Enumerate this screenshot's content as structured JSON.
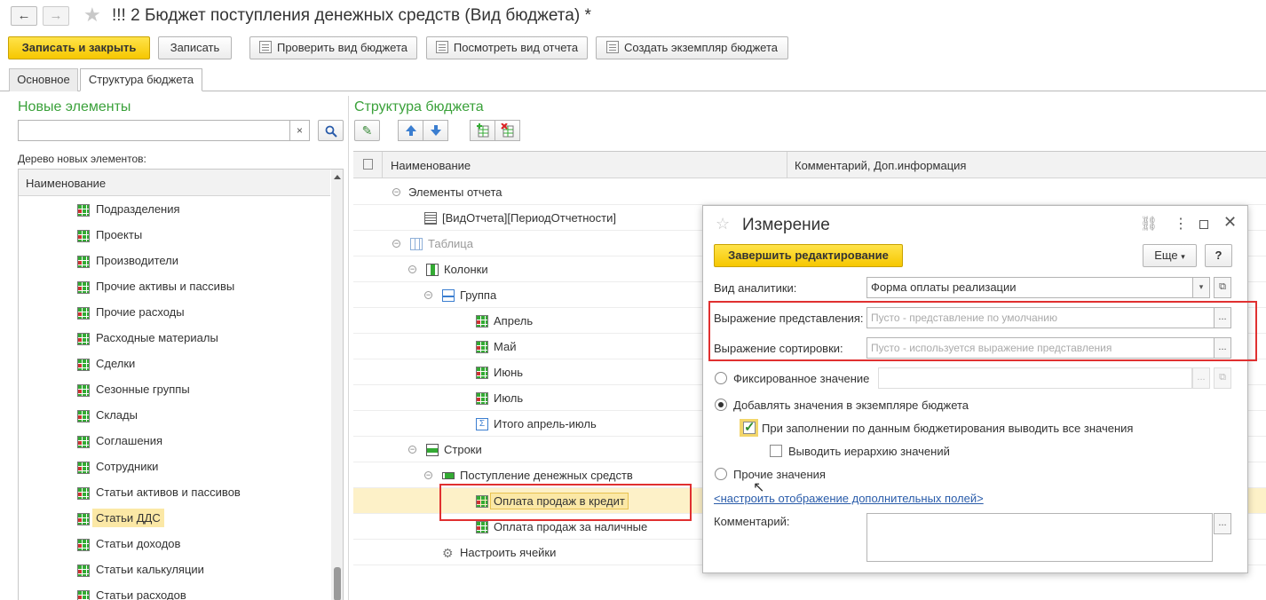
{
  "window": {
    "title": "!!! 2 Бюджет поступления денежных средств (Вид бюджета) *"
  },
  "toolbar": {
    "save_close": "Записать и закрыть",
    "save": "Записать",
    "check": "Проверить вид бюджета",
    "view_report": "Посмотреть вид отчета",
    "create_instance": "Создать экземпляр бюджета"
  },
  "tabs": [
    {
      "label": "Основное"
    },
    {
      "label": "Структура бюджета"
    }
  ],
  "left": {
    "heading": "Новые элементы",
    "search_value": "",
    "clear": "×",
    "tree_label": "Дерево новых элементов:",
    "col_name": "Наименование",
    "items": [
      {
        "label": "Подразделения"
      },
      {
        "label": "Проекты"
      },
      {
        "label": "Производители"
      },
      {
        "label": "Прочие активы и пассивы"
      },
      {
        "label": "Прочие расходы"
      },
      {
        "label": "Расходные материалы"
      },
      {
        "label": "Сделки"
      },
      {
        "label": "Сезонные группы"
      },
      {
        "label": "Склады"
      },
      {
        "label": "Соглашения"
      },
      {
        "label": "Сотрудники"
      },
      {
        "label": "Статьи активов и пассивов"
      },
      {
        "label": "Статьи ДДС"
      },
      {
        "label": "Статьи доходов"
      },
      {
        "label": "Статьи калькуляции"
      },
      {
        "label": "Статьи расходов"
      }
    ],
    "selected_index": 12
  },
  "right": {
    "heading": "Структура бюджета",
    "col_name": "Наименование",
    "col_comment": "Комментарий, Доп.информация",
    "rows": [
      {
        "label": "Элементы отчета"
      },
      {
        "label": "[ВидОтчета][ПериодОтчетности]"
      },
      {
        "label": "Таблица"
      },
      {
        "label": "Колонки"
      },
      {
        "label": "Группа"
      },
      {
        "label": "Апрель"
      },
      {
        "label": "Май"
      },
      {
        "label": "Июнь"
      },
      {
        "label": "Июль"
      },
      {
        "label": "Итого апрель-июль"
      },
      {
        "label": "Строки"
      },
      {
        "label": "Поступление денежных средств"
      },
      {
        "label": "Оплата продаж в кредит"
      },
      {
        "label": "Оплата продаж за наличные"
      },
      {
        "label": "Настроить ячейки"
      }
    ]
  },
  "dialog": {
    "title": "Измерение",
    "finish": "Завершить редактирование",
    "more": "Еще",
    "help": "?",
    "analytics_label": "Вид аналитики:",
    "analytics_value": "Форма оплаты реализации",
    "repr_label": "Выражение представления:",
    "repr_placeholder": "Пусто - представление по умолчанию",
    "sort_label": "Выражение сортировки:",
    "sort_placeholder": "Пусто - используется выражение представления",
    "fixed_label": "Фиксированное значение",
    "add_values_label": "Добавлять значения в экземпляре бюджета",
    "fill_all_label": "При заполнении по данным бюджетирования выводить все значения",
    "hierarchy_label": "Выводить иерархию значений",
    "other_label": "Прочие значения",
    "link": "<настроить отображение дополнительных полей>",
    "comment_label": "Комментарий:",
    "dots": "..."
  },
  "colors": {
    "accent_green": "#3aa13a",
    "highlight": "#fbe8a6",
    "red_frame": "#e03030",
    "link": "#2a5caa"
  }
}
